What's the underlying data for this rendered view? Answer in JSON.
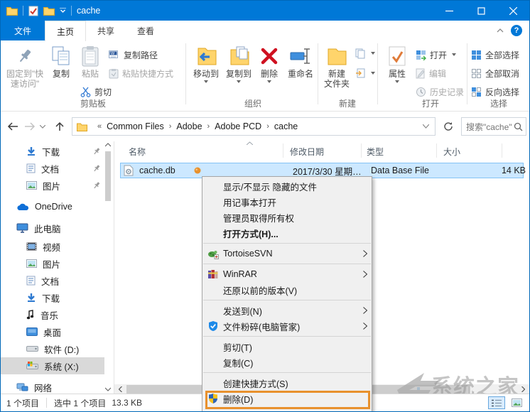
{
  "window": {
    "title": "cache"
  },
  "tabs": {
    "file": "文件",
    "home": "主页",
    "share": "共享",
    "view": "查看"
  },
  "ribbon": {
    "clipboard": {
      "group": "剪贴板",
      "pin1": "固定到\"快",
      "pin2": "速访问\"",
      "copy": "复制",
      "paste": "粘贴",
      "copy_path": "复制路径",
      "paste_shortcut": "粘贴快捷方式",
      "cut": "剪切"
    },
    "organize": {
      "group": "组织",
      "move_to": "移动到",
      "copy_to": "复制到",
      "delete": "删除",
      "rename": "重命名"
    },
    "new": {
      "group": "新建",
      "line1": "新建",
      "line2": "文件夹"
    },
    "open": {
      "group": "打开",
      "properties": "属性",
      "open": "打开",
      "edit": "编辑",
      "history": "历史记录"
    },
    "select": {
      "group": "选择",
      "all": "全部选择",
      "none": "全部取消",
      "invert": "反向选择"
    }
  },
  "address_bar": {
    "crumb_prefix": "«",
    "crumb_separator": "›",
    "crumbs": [
      "Common Files",
      "Adobe",
      "Adobe PCD",
      "cache"
    ],
    "search_placeholder": "搜索\"cache\""
  },
  "sidebar": {
    "items": [
      {
        "label": "下载"
      },
      {
        "label": "文档"
      },
      {
        "label": "图片"
      },
      {
        "label": "OneDrive"
      },
      {
        "label": "此电脑"
      },
      {
        "label": "视频"
      },
      {
        "label": "图片"
      },
      {
        "label": "文档"
      },
      {
        "label": "下载"
      },
      {
        "label": "音乐"
      },
      {
        "label": "桌面"
      },
      {
        "label": "软件 (D:)"
      },
      {
        "label": "系统 (X:)"
      },
      {
        "label": "网络"
      }
    ]
  },
  "file_list": {
    "columns": [
      "名称",
      "修改日期",
      "类型",
      "大小"
    ],
    "row": {
      "name": "cache.db",
      "date": "2017/3/30 星期…",
      "type": "Data Base File",
      "size": "14 KB"
    }
  },
  "context_menu": {
    "items": [
      {
        "label": "显示/不显示 隐藏的文件"
      },
      {
        "label": "用记事本打开"
      },
      {
        "label": "管理员取得所有权"
      },
      {
        "label": "打开方式(H)..."
      },
      {
        "label": "TortoiseSVN"
      },
      {
        "label": "WinRAR"
      },
      {
        "label": "还原以前的版本(V)"
      },
      {
        "label": "发送到(N)"
      },
      {
        "label": "文件粉碎(电脑管家)"
      },
      {
        "label": "剪切(T)"
      },
      {
        "label": "复制(C)"
      },
      {
        "label": "创建快捷方式(S)"
      },
      {
        "label": "删除(D)"
      }
    ]
  },
  "status_bar": {
    "count": "1 个项目",
    "selected": "选中 1 个项目",
    "size": "13.3 KB"
  },
  "watermark": {
    "text": "系统之家"
  },
  "colors": {
    "accent": "#0078d7",
    "selection": "#cce8ff",
    "annotation": "#e8912d"
  }
}
